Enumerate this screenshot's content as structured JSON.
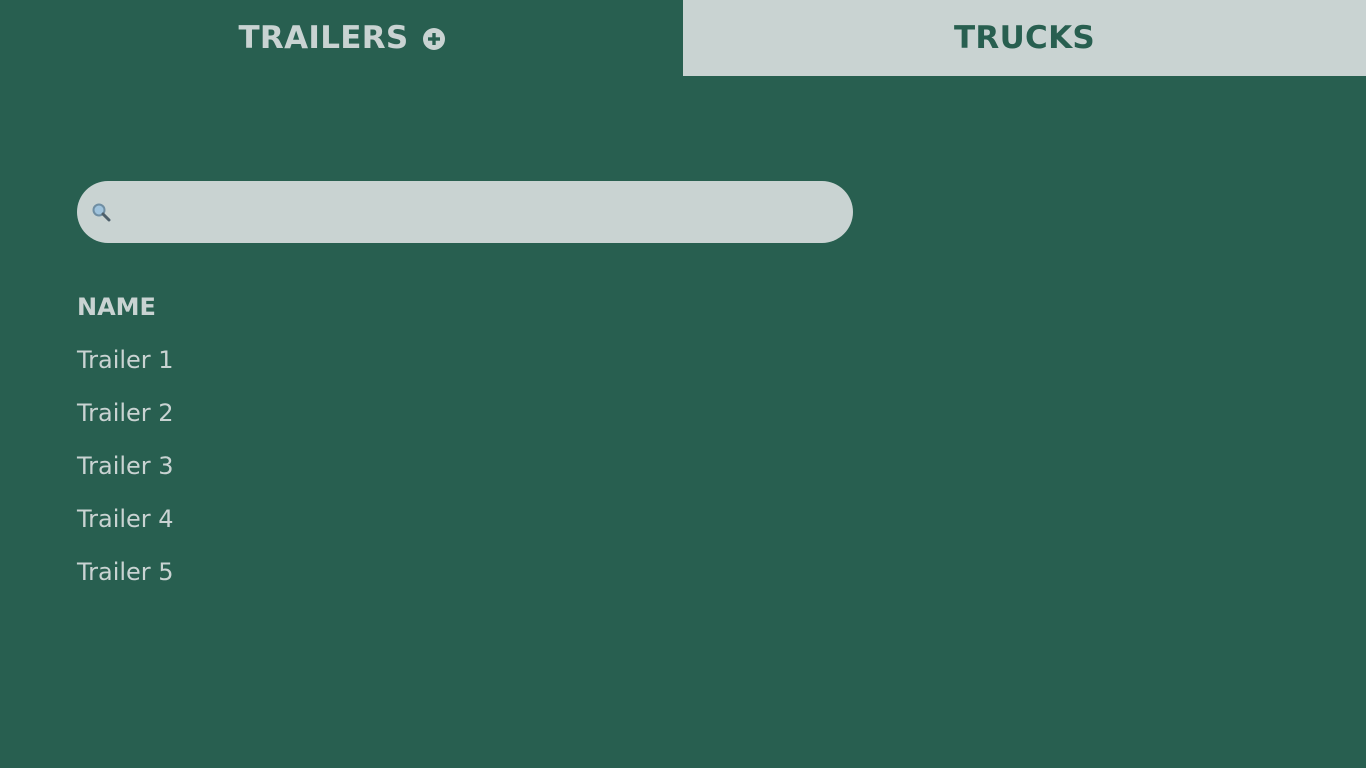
{
  "tabs": [
    {
      "label": "TRAILERS",
      "active": true,
      "icon": "plus-circle-icon"
    },
    {
      "label": "TRUCKS",
      "active": false
    }
  ],
  "search": {
    "icon": "search-icon",
    "value": "",
    "placeholder": ""
  },
  "table": {
    "columns": [
      "NAME"
    ],
    "rows": [
      "Trailer 1",
      "Trailer 2",
      "Trailer 3",
      "Trailer 4",
      "Trailer 5"
    ]
  },
  "colors": {
    "background": "#285f50",
    "light": "#c9d3d2"
  }
}
